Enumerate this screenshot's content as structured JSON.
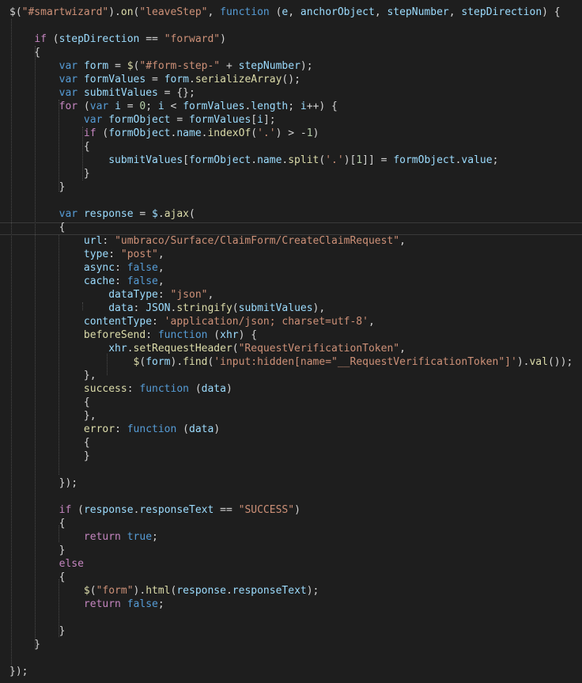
{
  "editor": {
    "lines": [
      [
        [
          "$(",
          "pun"
        ],
        [
          "\"#smartwizard\"",
          "str"
        ],
        [
          ").",
          "pun"
        ],
        [
          "on",
          "fn"
        ],
        [
          "(",
          "pun"
        ],
        [
          "\"leaveStep\"",
          "str"
        ],
        [
          ", ",
          "pun"
        ],
        [
          "function",
          "kw"
        ],
        [
          " (",
          "pun"
        ],
        [
          "e",
          "var"
        ],
        [
          ", ",
          "pun"
        ],
        [
          "anchorObject",
          "var"
        ],
        [
          ", ",
          "pun"
        ],
        [
          "stepNumber",
          "var"
        ],
        [
          ", ",
          "pun"
        ],
        [
          "stepDirection",
          "var"
        ],
        [
          ") {",
          "pun"
        ]
      ],
      [],
      [
        [
          "    ",
          "pun"
        ],
        [
          "if",
          "ctl"
        ],
        [
          " (",
          "pun"
        ],
        [
          "stepDirection",
          "var"
        ],
        [
          " == ",
          "pun"
        ],
        [
          "\"forward\"",
          "str"
        ],
        [
          ")",
          "pun"
        ]
      ],
      [
        [
          "    {",
          "pun"
        ]
      ],
      [
        [
          "        ",
          "pun"
        ],
        [
          "var",
          "kw"
        ],
        [
          " ",
          "pun"
        ],
        [
          "form",
          "var"
        ],
        [
          " = ",
          "pun"
        ],
        [
          "$",
          "fn"
        ],
        [
          "(",
          "pun"
        ],
        [
          "\"#form-step-\"",
          "str"
        ],
        [
          " + ",
          "pun"
        ],
        [
          "stepNumber",
          "var"
        ],
        [
          ");",
          "pun"
        ]
      ],
      [
        [
          "        ",
          "pun"
        ],
        [
          "var",
          "kw"
        ],
        [
          " ",
          "pun"
        ],
        [
          "formValues",
          "var"
        ],
        [
          " = ",
          "pun"
        ],
        [
          "form",
          "var"
        ],
        [
          ".",
          "pun"
        ],
        [
          "serializeArray",
          "fn"
        ],
        [
          "();",
          "pun"
        ]
      ],
      [
        [
          "        ",
          "pun"
        ],
        [
          "var",
          "kw"
        ],
        [
          " ",
          "pun"
        ],
        [
          "submitValues",
          "var"
        ],
        [
          " = {};",
          "pun"
        ]
      ],
      [
        [
          "        ",
          "pun"
        ],
        [
          "for",
          "ctl"
        ],
        [
          " (",
          "pun"
        ],
        [
          "var",
          "kw"
        ],
        [
          " ",
          "pun"
        ],
        [
          "i",
          "var"
        ],
        [
          " = ",
          "pun"
        ],
        [
          "0",
          "num"
        ],
        [
          "; ",
          "pun"
        ],
        [
          "i",
          "var"
        ],
        [
          " < ",
          "pun"
        ],
        [
          "formValues",
          "var"
        ],
        [
          ".",
          "pun"
        ],
        [
          "length",
          "var"
        ],
        [
          "; ",
          "pun"
        ],
        [
          "i",
          "var"
        ],
        [
          "++) {",
          "pun"
        ]
      ],
      [
        [
          "            ",
          "pun"
        ],
        [
          "var",
          "kw"
        ],
        [
          " ",
          "pun"
        ],
        [
          "formObject",
          "var"
        ],
        [
          " = ",
          "pun"
        ],
        [
          "formValues",
          "var"
        ],
        [
          "[",
          "pun"
        ],
        [
          "i",
          "var"
        ],
        [
          "];",
          "pun"
        ]
      ],
      [
        [
          "            ",
          "pun"
        ],
        [
          "if",
          "ctl"
        ],
        [
          " (",
          "pun"
        ],
        [
          "formObject",
          "var"
        ],
        [
          ".",
          "pun"
        ],
        [
          "name",
          "var"
        ],
        [
          ".",
          "pun"
        ],
        [
          "indexOf",
          "fn"
        ],
        [
          "(",
          "pun"
        ],
        [
          "'.'",
          "str"
        ],
        [
          ") > -",
          "pun"
        ],
        [
          "1",
          "num"
        ],
        [
          ")",
          "pun"
        ]
      ],
      [
        [
          "            {",
          "pun"
        ]
      ],
      [
        [
          "                ",
          "pun"
        ],
        [
          "submitValues",
          "var"
        ],
        [
          "[",
          "pun"
        ],
        [
          "formObject",
          "var"
        ],
        [
          ".",
          "pun"
        ],
        [
          "name",
          "var"
        ],
        [
          ".",
          "pun"
        ],
        [
          "split",
          "fn"
        ],
        [
          "(",
          "pun"
        ],
        [
          "'.'",
          "str"
        ],
        [
          ")[",
          "pun"
        ],
        [
          "1",
          "num"
        ],
        [
          "]] = ",
          "pun"
        ],
        [
          "formObject",
          "var"
        ],
        [
          ".",
          "pun"
        ],
        [
          "value",
          "var"
        ],
        [
          ";",
          "pun"
        ]
      ],
      [
        [
          "            }",
          "pun"
        ]
      ],
      [
        [
          "        }",
          "pun"
        ]
      ],
      [],
      [
        [
          "        ",
          "pun"
        ],
        [
          "var",
          "kw"
        ],
        [
          " ",
          "pun"
        ],
        [
          "response",
          "var"
        ],
        [
          " = ",
          "pun"
        ],
        [
          "$",
          "var"
        ],
        [
          ".",
          "pun"
        ],
        [
          "ajax",
          "fn"
        ],
        [
          "(",
          "pun"
        ]
      ],
      [
        [
          "        {",
          "pun"
        ]
      ],
      [
        [
          "            ",
          "pun"
        ],
        [
          "url",
          "var"
        ],
        [
          ": ",
          "pun"
        ],
        [
          "\"umbraco/Surface/ClaimForm/CreateClaimRequest\"",
          "str"
        ],
        [
          ",",
          "pun"
        ]
      ],
      [
        [
          "            ",
          "pun"
        ],
        [
          "type",
          "var"
        ],
        [
          ": ",
          "pun"
        ],
        [
          "\"post\"",
          "str"
        ],
        [
          ",",
          "pun"
        ]
      ],
      [
        [
          "            ",
          "pun"
        ],
        [
          "async",
          "var"
        ],
        [
          ": ",
          "pun"
        ],
        [
          "false",
          "kw"
        ],
        [
          ",",
          "pun"
        ]
      ],
      [
        [
          "            ",
          "pun"
        ],
        [
          "cache",
          "var"
        ],
        [
          ": ",
          "pun"
        ],
        [
          "false",
          "kw"
        ],
        [
          ",",
          "pun"
        ]
      ],
      [
        [
          "                ",
          "pun"
        ],
        [
          "dataType",
          "var"
        ],
        [
          ": ",
          "pun"
        ],
        [
          "\"json\"",
          "str"
        ],
        [
          ",",
          "pun"
        ]
      ],
      [
        [
          "                ",
          "pun"
        ],
        [
          "data",
          "var"
        ],
        [
          ": ",
          "pun"
        ],
        [
          "JSON",
          "var"
        ],
        [
          ".",
          "pun"
        ],
        [
          "stringify",
          "fn"
        ],
        [
          "(",
          "pun"
        ],
        [
          "submitValues",
          "var"
        ],
        [
          "),",
          "pun"
        ]
      ],
      [
        [
          "            ",
          "pun"
        ],
        [
          "contentType",
          "var"
        ],
        [
          ": ",
          "pun"
        ],
        [
          "'application/json; charset=utf-8'",
          "str"
        ],
        [
          ",",
          "pun"
        ]
      ],
      [
        [
          "            ",
          "pun"
        ],
        [
          "beforeSend",
          "fn"
        ],
        [
          ": ",
          "pun"
        ],
        [
          "function",
          "kw"
        ],
        [
          " (",
          "pun"
        ],
        [
          "xhr",
          "var"
        ],
        [
          ") {",
          "pun"
        ]
      ],
      [
        [
          "                ",
          "pun"
        ],
        [
          "xhr",
          "var"
        ],
        [
          ".",
          "pun"
        ],
        [
          "setRequestHeader",
          "fn"
        ],
        [
          "(",
          "pun"
        ],
        [
          "\"RequestVerificationToken\"",
          "str"
        ],
        [
          ",",
          "pun"
        ]
      ],
      [
        [
          "                    ",
          "pun"
        ],
        [
          "$",
          "fn"
        ],
        [
          "(",
          "pun"
        ],
        [
          "form",
          "var"
        ],
        [
          ").",
          "pun"
        ],
        [
          "find",
          "fn"
        ],
        [
          "(",
          "pun"
        ],
        [
          "'input:hidden[name=\"__RequestVerificationToken\"]'",
          "str"
        ],
        [
          ").",
          "pun"
        ],
        [
          "val",
          "fn"
        ],
        [
          "());",
          "pun"
        ]
      ],
      [
        [
          "            },",
          "pun"
        ]
      ],
      [
        [
          "            ",
          "pun"
        ],
        [
          "success",
          "fn"
        ],
        [
          ": ",
          "pun"
        ],
        [
          "function",
          "kw"
        ],
        [
          " (",
          "pun"
        ],
        [
          "data",
          "var"
        ],
        [
          ")",
          "pun"
        ]
      ],
      [
        [
          "            {",
          "pun"
        ]
      ],
      [
        [
          "            },",
          "pun"
        ]
      ],
      [
        [
          "            ",
          "pun"
        ],
        [
          "error",
          "fn"
        ],
        [
          ": ",
          "pun"
        ],
        [
          "function",
          "kw"
        ],
        [
          " (",
          "pun"
        ],
        [
          "data",
          "var"
        ],
        [
          ")",
          "pun"
        ]
      ],
      [
        [
          "            {",
          "pun"
        ]
      ],
      [
        [
          "            }",
          "pun"
        ]
      ],
      [],
      [
        [
          "        });",
          "pun"
        ]
      ],
      [],
      [
        [
          "        ",
          "pun"
        ],
        [
          "if",
          "ctl"
        ],
        [
          " (",
          "pun"
        ],
        [
          "response",
          "var"
        ],
        [
          ".",
          "pun"
        ],
        [
          "responseText",
          "var"
        ],
        [
          " == ",
          "pun"
        ],
        [
          "\"SUCCESS\"",
          "str"
        ],
        [
          ")",
          "pun"
        ]
      ],
      [
        [
          "        {",
          "pun"
        ]
      ],
      [
        [
          "            ",
          "pun"
        ],
        [
          "return",
          "ctl"
        ],
        [
          " ",
          "pun"
        ],
        [
          "true",
          "kw"
        ],
        [
          ";",
          "pun"
        ]
      ],
      [
        [
          "        }",
          "pun"
        ]
      ],
      [
        [
          "        ",
          "pun"
        ],
        [
          "else",
          "ctl"
        ]
      ],
      [
        [
          "        {",
          "pun"
        ]
      ],
      [
        [
          "            ",
          "pun"
        ],
        [
          "$",
          "fn"
        ],
        [
          "(",
          "pun"
        ],
        [
          "\"form\"",
          "str"
        ],
        [
          ").",
          "pun"
        ],
        [
          "html",
          "fn"
        ],
        [
          "(",
          "pun"
        ],
        [
          "response",
          "var"
        ],
        [
          ".",
          "pun"
        ],
        [
          "responseText",
          "var"
        ],
        [
          ");",
          "pun"
        ]
      ],
      [
        [
          "            ",
          "pun"
        ],
        [
          "return",
          "ctl"
        ],
        [
          " ",
          "pun"
        ],
        [
          "false",
          "kw"
        ],
        [
          ";",
          "pun"
        ]
      ],
      [],
      [
        [
          "        }",
          "pun"
        ]
      ],
      [
        [
          "    }",
          "pun"
        ]
      ],
      [],
      [
        [
          "});",
          "pun"
        ]
      ]
    ]
  }
}
